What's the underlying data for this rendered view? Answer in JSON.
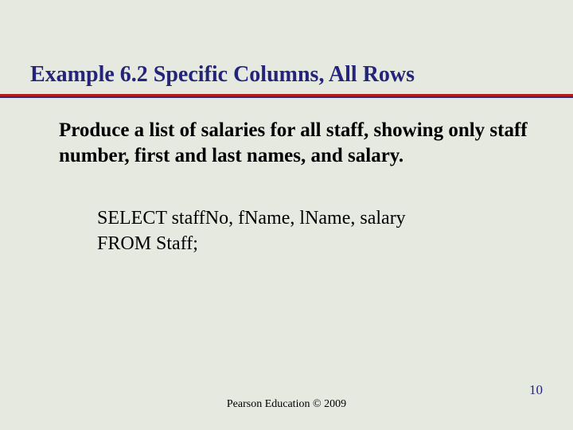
{
  "heading": "Example 6.2  Specific Columns, All Rows",
  "body": "Produce a list of salaries for all staff, showing only staff number, first and last names, and salary.",
  "sql": {
    "line1": "SELECT staffNo, fName, lName, salary",
    "line2": "FROM Staff;"
  },
  "footer": "Pearson Education © 2009",
  "page_number": "10"
}
